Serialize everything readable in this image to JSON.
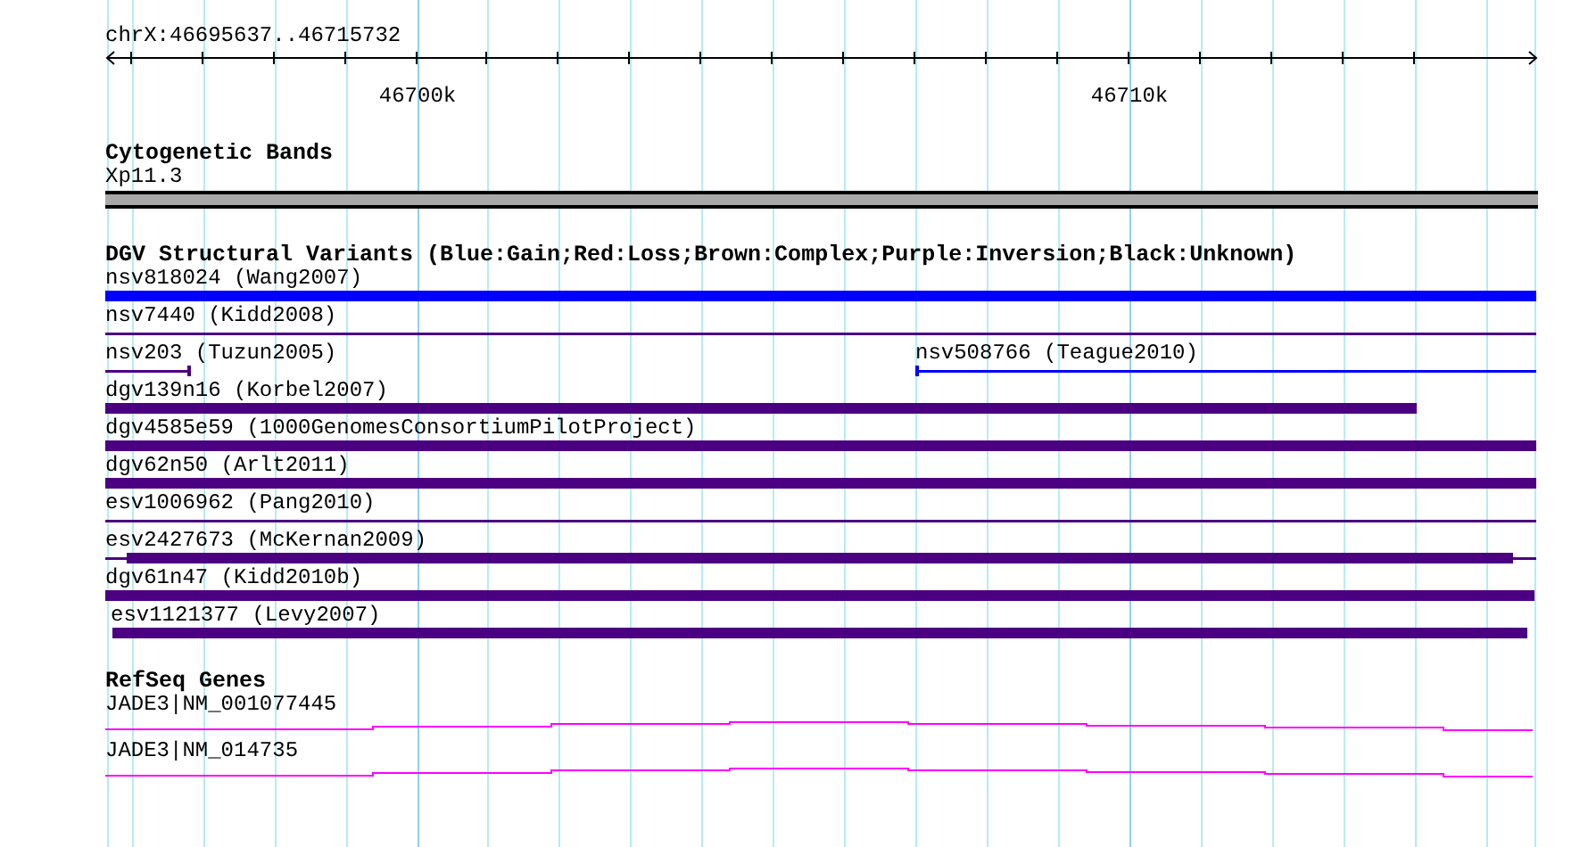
{
  "ruler": {
    "position": "chrX:46695637..46715732",
    "tick_labels": [
      "46700k",
      "46710k"
    ]
  },
  "cytogenetic_bands": {
    "title": "Cytogenetic Bands",
    "bands": [
      "Xp11.3"
    ]
  },
  "dgv_variants": {
    "title": "DGV Structural Variants (Blue:Gain;Red:Loss;Brown:Complex;Purple:Inversion;Black:Unknown)",
    "rows": [
      {
        "features": [
          {
            "label": "nsv818024 (Wang2007)",
            "color": "#0000ff"
          }
        ]
      },
      {
        "features": [
          {
            "label": "nsv7440 (Kidd2008)",
            "color": "#4b0082"
          }
        ]
      },
      {
        "features": [
          {
            "label": "nsv203 (Tuzun2005)",
            "color": "#4b0082"
          },
          {
            "label": "nsv508766 (Teague2010)",
            "color": "#0000ff"
          }
        ]
      },
      {
        "features": [
          {
            "label": "dgv139n16 (Korbel2007)",
            "color": "#4b0082"
          }
        ]
      },
      {
        "features": [
          {
            "label": "dgv4585e59 (1000GenomesConsortiumPilotProject)",
            "color": "#4b0082"
          }
        ]
      },
      {
        "features": [
          {
            "label": "dgv62n50 (Arlt2011)",
            "color": "#4b0082"
          }
        ]
      },
      {
        "features": [
          {
            "label": "esv1006962 (Pang2010)",
            "color": "#4b0082"
          }
        ]
      },
      {
        "features": [
          {
            "label": "esv2427673 (McKernan2009)",
            "color": "#4b0082"
          }
        ]
      },
      {
        "features": [
          {
            "label": "dgv61n47 (Kidd2010b)",
            "color": "#4b0082"
          }
        ]
      },
      {
        "features": [
          {
            "label": "esv1121377 (Levy2007)",
            "color": "#4b0082"
          }
        ]
      }
    ]
  },
  "refseq_genes": {
    "title": "RefSeq Genes",
    "genes": [
      {
        "label": "JADE3|NM_001077445"
      },
      {
        "label": "JADE3|NM_014735"
      }
    ]
  }
}
